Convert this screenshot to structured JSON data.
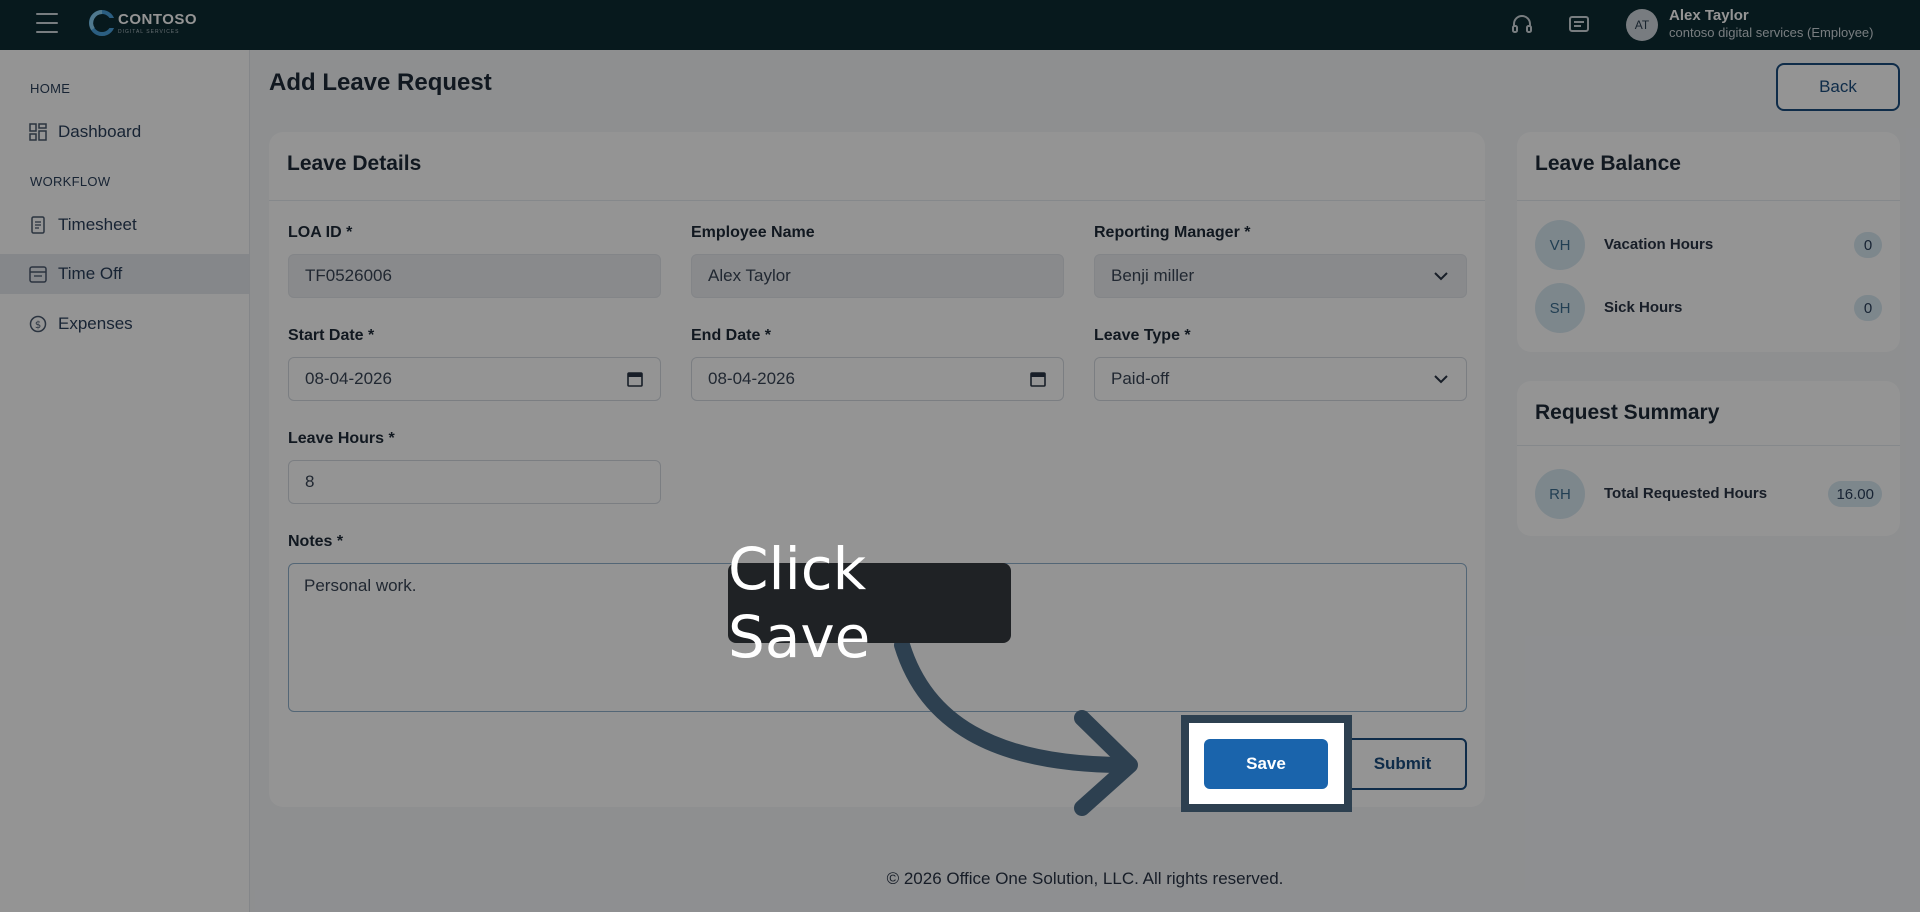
{
  "header": {
    "logo_text": "CONTOSO",
    "logo_sub": "DIGITAL SERVICES",
    "user_initials": "AT",
    "user_name": "Alex Taylor",
    "user_org": "contoso digital services (Employee)"
  },
  "sidebar": {
    "home_heading": "HOME",
    "workflow_heading": "WORKFLOW",
    "items": [
      {
        "label": "Dashboard",
        "icon": "dashboard-icon"
      },
      {
        "label": "Timesheet",
        "icon": "timesheet-icon"
      },
      {
        "label": "Time Off",
        "icon": "calendar-icon",
        "active": true
      },
      {
        "label": "Expenses",
        "icon": "dollar-icon"
      }
    ]
  },
  "page": {
    "title": "Add Leave Request",
    "back_label": "Back"
  },
  "leave_details": {
    "title": "Leave Details",
    "loa_id_label": "LOA ID *",
    "loa_id_value": "TF0526006",
    "employee_name_label": "Employee Name",
    "employee_name_value": "Alex Taylor",
    "manager_label": "Reporting Manager *",
    "manager_value": "Benji miller",
    "start_date_label": "Start Date *",
    "start_date_value": "08-04-2026",
    "end_date_label": "End Date *",
    "end_date_value": "08-04-2026",
    "leave_type_label": "Leave Type *",
    "leave_type_value": "Paid-off",
    "leave_hours_label": "Leave Hours *",
    "leave_hours_value": "8",
    "notes_label": "Notes *",
    "notes_value": "Personal work.",
    "save_label": "Save",
    "submit_label": "Submit"
  },
  "leave_balance": {
    "title": "Leave Balance",
    "rows": [
      {
        "initials": "VH",
        "label": "Vacation Hours",
        "value": "0"
      },
      {
        "initials": "SH",
        "label": "Sick Hours",
        "value": "0"
      }
    ]
  },
  "request_summary": {
    "title": "Request Summary",
    "rows": [
      {
        "initials": "RH",
        "label": "Total Requested Hours",
        "value": "16.00"
      }
    ]
  },
  "footer": {
    "text": "© 2026 Office One Solution, LLC. All rights reserved."
  },
  "tutorial": {
    "tooltip_text": "Click Save"
  },
  "colors": {
    "topbar": "#0d2b32",
    "primary": "#1a64ac",
    "accent_border": "#1b4d7e"
  }
}
